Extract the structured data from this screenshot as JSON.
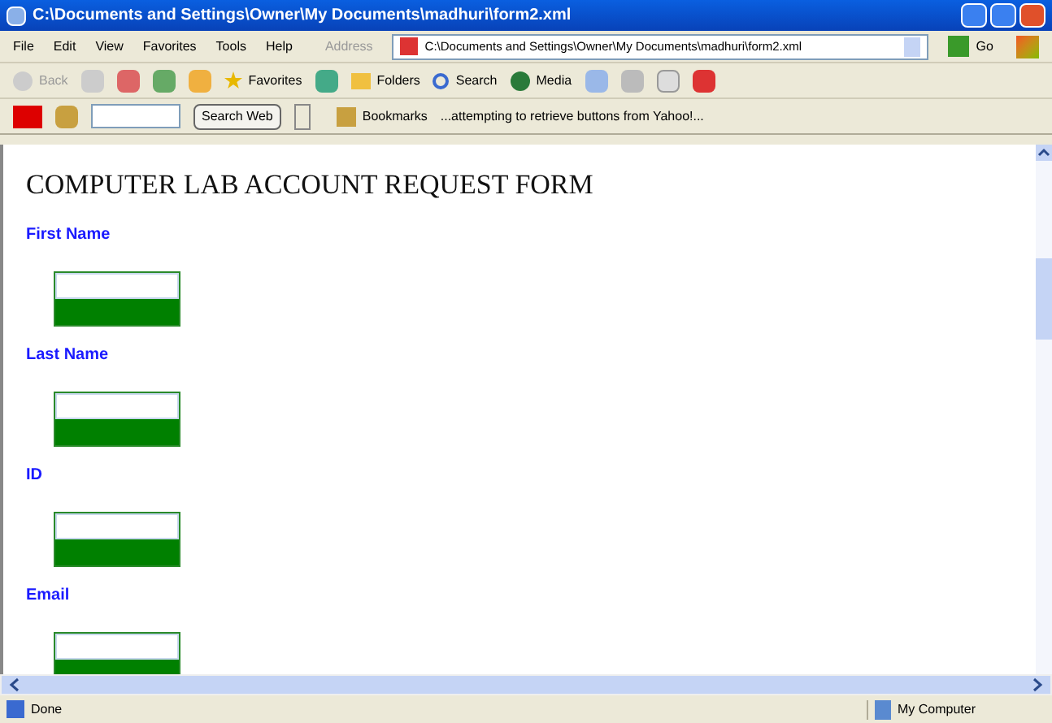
{
  "window": {
    "title": "C:\\Documents and Settings\\Owner\\My Documents\\madhuri\\form2.xml"
  },
  "menu": [
    "File",
    "Edit",
    "View",
    "Favorites",
    "Tools",
    "Help"
  ],
  "address": {
    "label": "Address",
    "value": "C:\\Documents and Settings\\Owner\\My Documents\\madhuri\\form2.xml",
    "go": "Go"
  },
  "toolbar": {
    "back": "Back",
    "favorites": "Favorites",
    "folders": "Folders",
    "search": "Search",
    "media": "Media"
  },
  "yahoo": {
    "search_button": "Search Web",
    "bookmarks": "Bookmarks",
    "status": "...attempting to retrieve buttons from Yahoo!..."
  },
  "page": {
    "heading": "COMPUTER LAB ACCOUNT REQUEST FORM",
    "fields": [
      {
        "label": "First Name"
      },
      {
        "label": "Last Name"
      },
      {
        "label": "ID"
      },
      {
        "label": "Email"
      }
    ]
  },
  "status_bar": {
    "text": "Done",
    "zone": "My Computer"
  }
}
